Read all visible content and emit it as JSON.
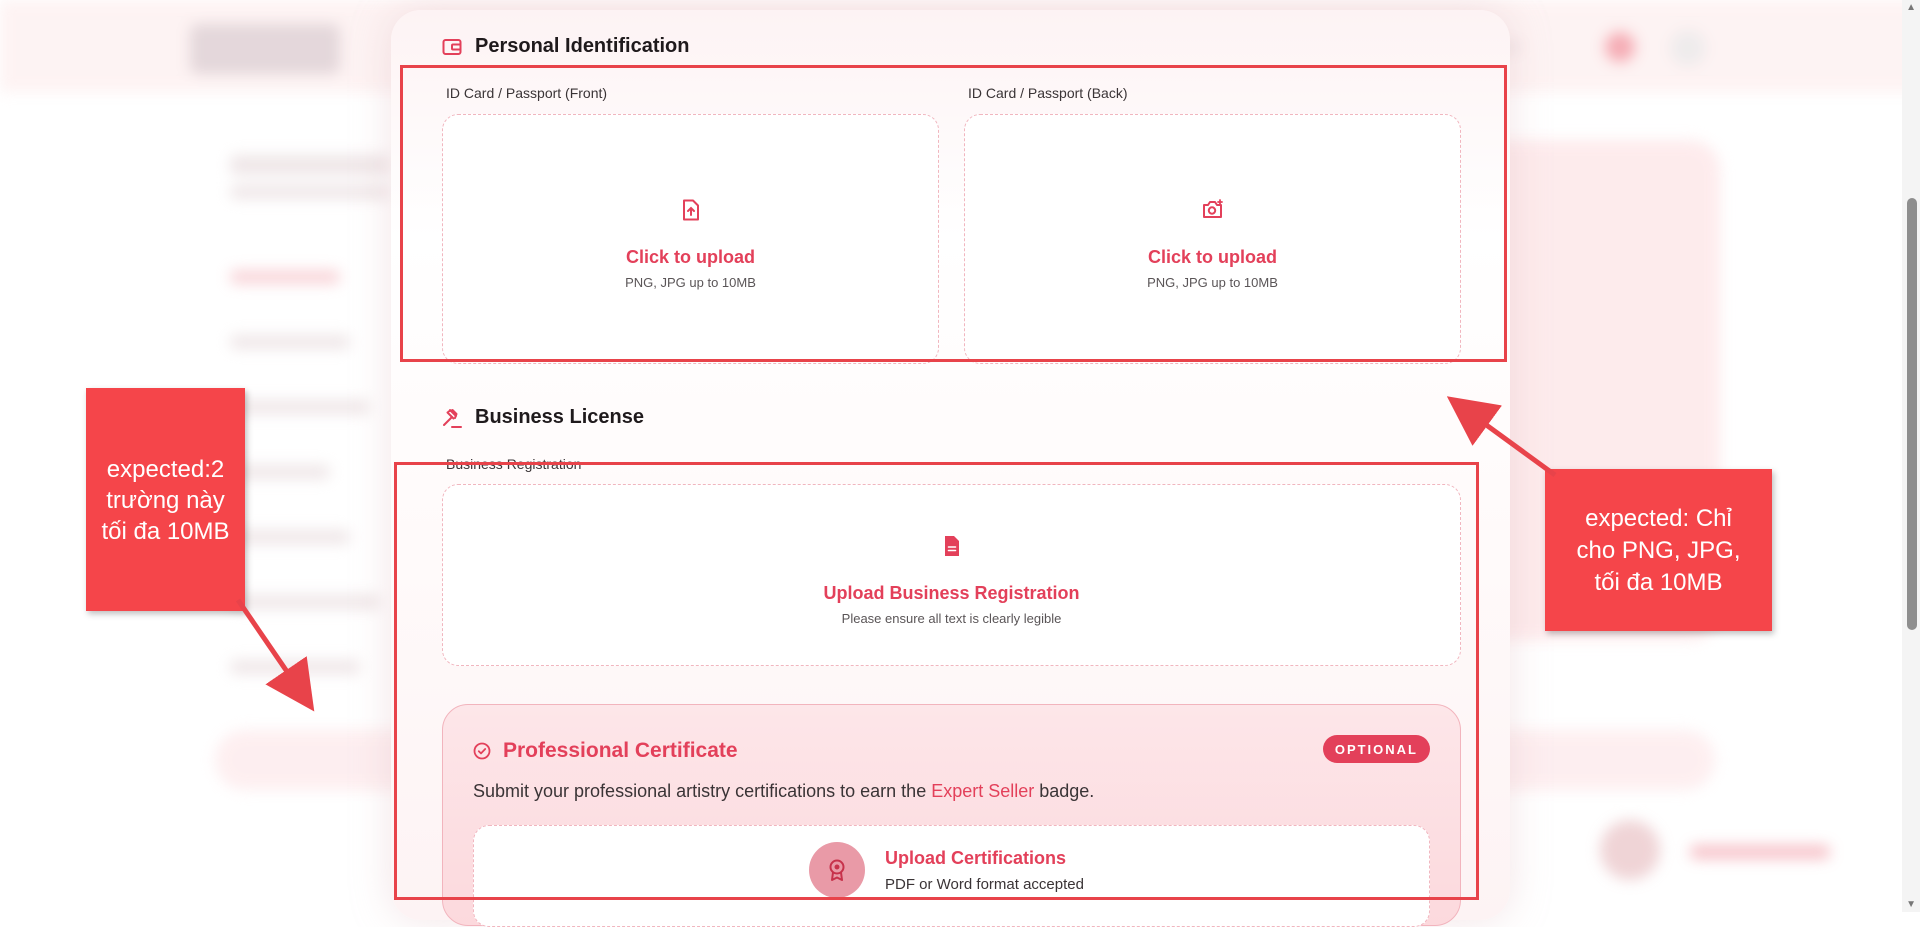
{
  "personal_id": {
    "title": "Personal Identification",
    "front": {
      "label": "ID Card / Passport (Front)",
      "action": "Click to upload",
      "hint": "PNG, JPG up to 10MB",
      "icon": "file-upload-icon"
    },
    "back": {
      "label": "ID Card / Passport (Back)",
      "action": "Click to upload",
      "hint": "PNG, JPG up to 10MB",
      "icon": "camera-plus-icon"
    }
  },
  "business_license": {
    "title": "Business License",
    "registration": {
      "label": "Business Registration",
      "action": "Upload Business Registration",
      "hint": "Please ensure all text is clearly legible",
      "icon": "document-icon"
    }
  },
  "certificate": {
    "title": "Professional Certificate",
    "badge": "OPTIONAL",
    "desc_before": "Submit your professional artistry certifications to earn the ",
    "desc_highlight": "Expert Seller",
    "desc_after": " badge.",
    "upload_title": "Upload Certifications",
    "upload_hint": "PDF or Word format accepted"
  },
  "annotations": {
    "left_note": {
      "line1": "expected:2",
      "line2": "trường này",
      "line3": "tối đa 10MB"
    },
    "right_note": {
      "line1": "expected: Chỉ",
      "line2": "cho PNG, JPG,",
      "line3": "tối đa 10MB"
    }
  },
  "colors": {
    "accent": "#e3405a",
    "annotation": "#f5454a"
  }
}
